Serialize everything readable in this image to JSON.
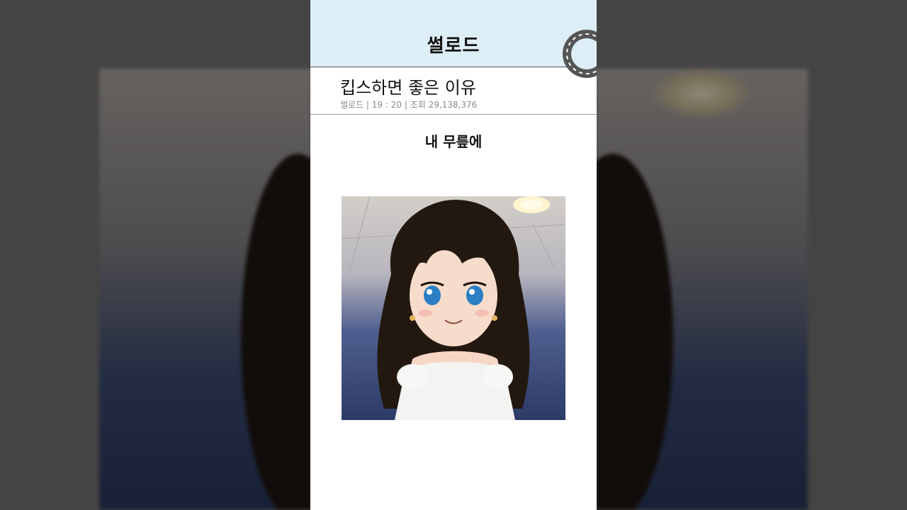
{
  "header": {
    "brand": "썰로드",
    "road_icon": "road-icon"
  },
  "post": {
    "title": "킵스하면 좋은 이유",
    "meta": "썰로드 | 19 : 20 | 조회 29,138,376",
    "caption": "내 무릎에"
  },
  "image": {
    "icon": "illustration-girl-image"
  },
  "colors": {
    "header_bg": "#ddeef6",
    "page_bg": "#ffffff",
    "backdrop": "#444444"
  }
}
